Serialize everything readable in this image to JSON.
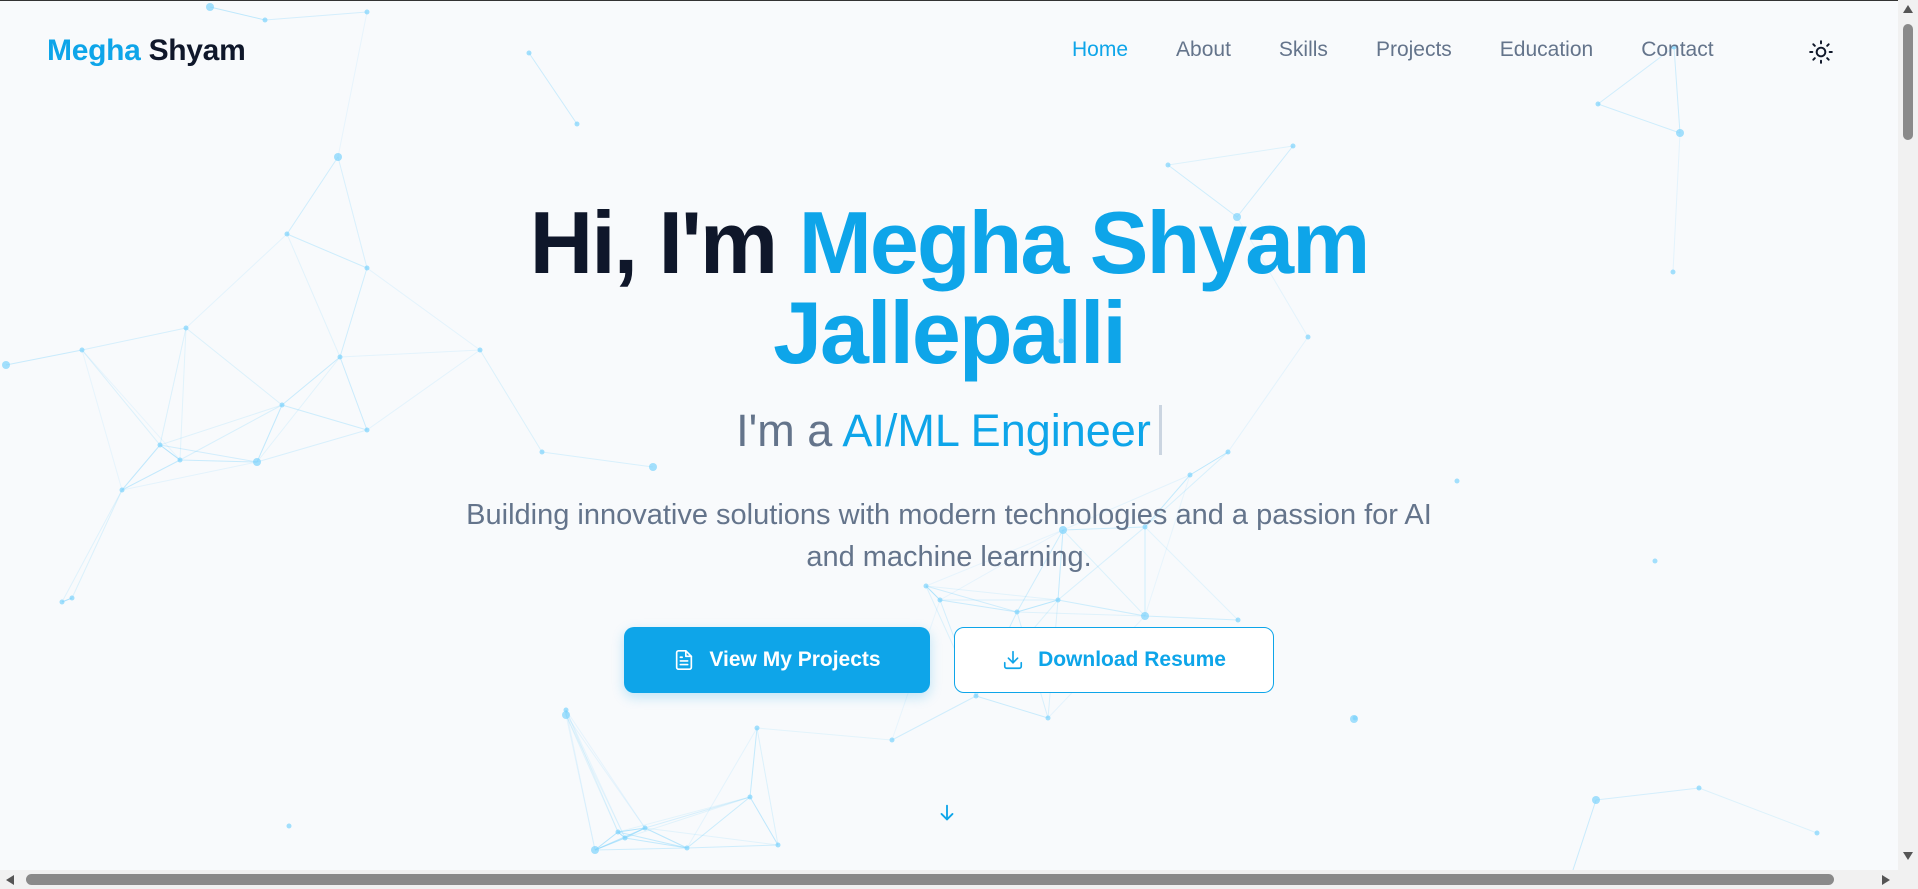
{
  "brand": {
    "first": "Megha",
    "second": "Shyam"
  },
  "nav": {
    "items": [
      {
        "label": "Home",
        "active": true
      },
      {
        "label": "About",
        "active": false
      },
      {
        "label": "Skills",
        "active": false
      },
      {
        "label": "Projects",
        "active": false
      },
      {
        "label": "Education",
        "active": false
      },
      {
        "label": "Contact",
        "active": false
      }
    ],
    "theme_toggle_icon": "sun-icon"
  },
  "hero": {
    "greeting": "Hi, I'm",
    "name_line1": "Megha Shyam",
    "name_line2": "Jallepalli",
    "role_prefix": "I'm a",
    "role": "AI/ML Engineer",
    "tagline": "Building innovative solutions with modern technologies and a passion for AI and machine learning."
  },
  "buttons": {
    "primary": {
      "label": "View My Projects",
      "icon": "document-icon"
    },
    "secondary": {
      "label": "Download Resume",
      "icon": "download-icon"
    }
  },
  "scroll_indicator_icon": "arrow-down-icon",
  "colors": {
    "accent": "#0ea5e9",
    "heading": "#0f172a",
    "muted": "#64748b",
    "background": "#f8fafc",
    "network": "#7dd3fc"
  }
}
